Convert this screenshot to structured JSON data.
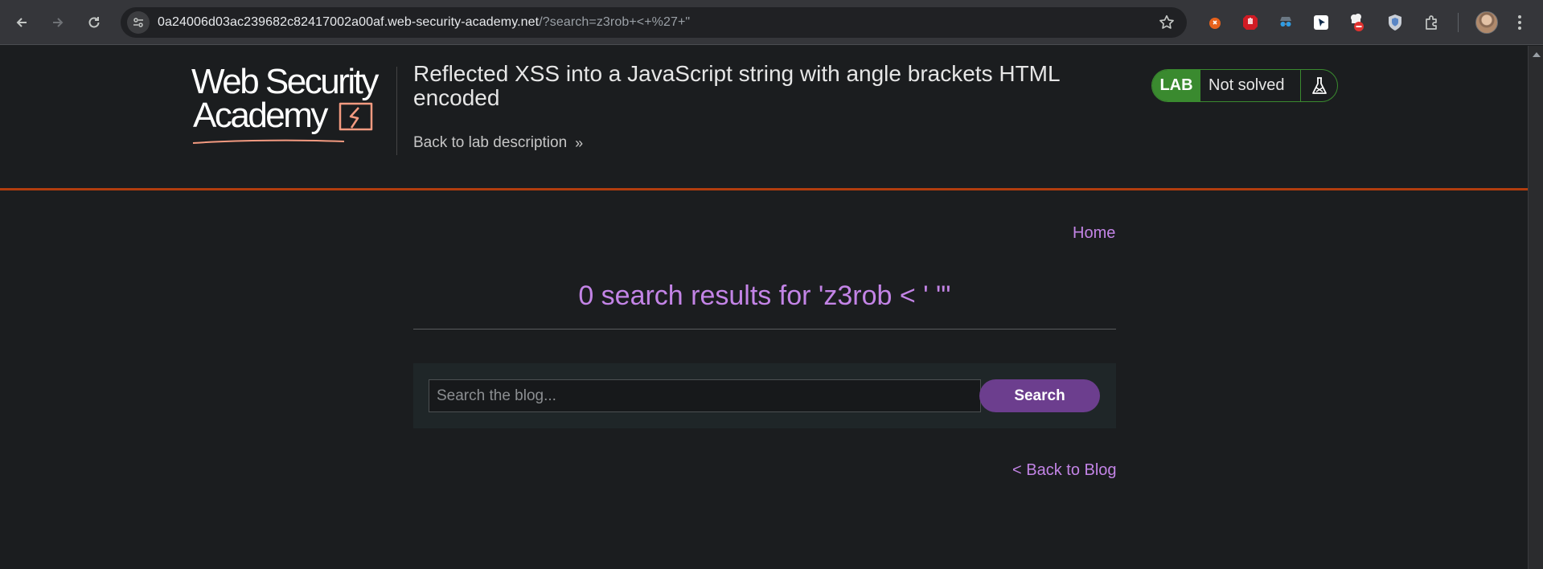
{
  "browser": {
    "url_host": "0a24006d03ac239682c82417002a00af.web-security-academy.net",
    "url_path": "/?search=z3rob+<+%27+\"",
    "back_icon": "arrow-left-icon",
    "forward_icon": "arrow-right-icon",
    "reload_icon": "reload-icon",
    "site_info_icon": "tune-icon",
    "bookmark_icon": "star-icon",
    "extensions": [
      "burp-extension-icon",
      "ublock-icon",
      "spy-extension-icon",
      "cursor-extension-icon",
      "chef-extension-icon",
      "shield-extension-icon",
      "puzzle-icon"
    ],
    "profile_icon": "avatar",
    "menu_icon": "kebab-menu-icon"
  },
  "header": {
    "logo_line1": "Web Security",
    "logo_line2": "Academy",
    "lab_title": "Reflected XSS into a JavaScript string with angle brackets HTML encoded",
    "back_to_description": "Back to lab description",
    "back_chevron": "»",
    "lab_badge": "LAB",
    "lab_status": "Not solved",
    "flask_icon": "flask-icon",
    "colors": {
      "accent_rule": "#b23d0e",
      "lab_green": "#3a8a2f"
    }
  },
  "main": {
    "home_link": "Home",
    "results_heading": "0 search results for 'z3rob < ' \"'",
    "search": {
      "placeholder": "Search the blog...",
      "value": "",
      "button_label": "Search"
    },
    "back_to_blog": "< Back to Blog",
    "colors": {
      "link": "#c384e6",
      "button": "#6c3e8e"
    }
  }
}
